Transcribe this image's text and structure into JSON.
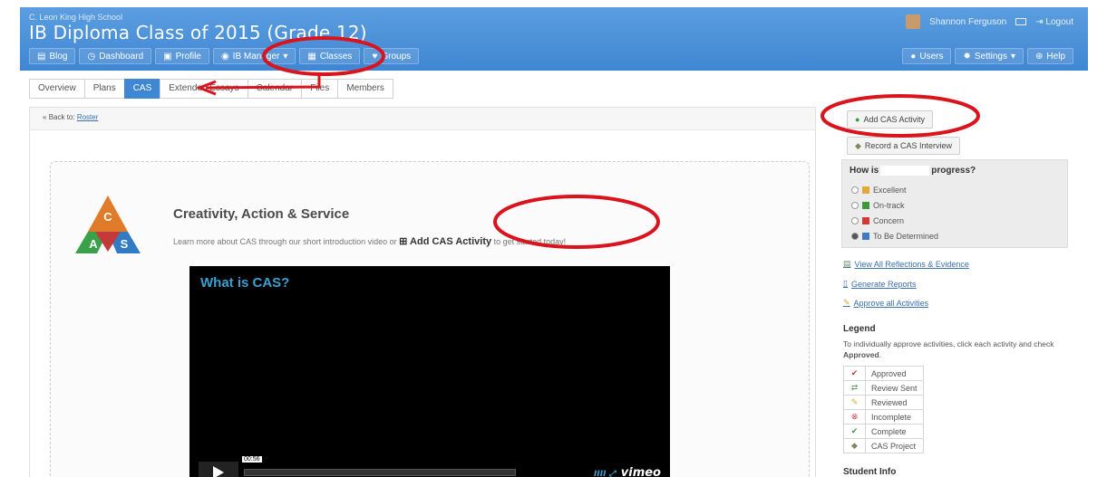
{
  "header": {
    "school": "C. Leon King High School",
    "class_title": "IB Diploma Class of 2015 (Grade 12)",
    "user_name": "Shannon Ferguson",
    "logout": "Logout"
  },
  "nav": {
    "items": [
      {
        "label": "Blog",
        "icon": "blog-icon"
      },
      {
        "label": "Dashboard",
        "icon": "dashboard-icon"
      },
      {
        "label": "Profile",
        "icon": "profile-icon"
      },
      {
        "label": "IB Manager",
        "icon": "globe-icon"
      },
      {
        "label": "Classes",
        "icon": "classes-icon"
      },
      {
        "label": "Groups",
        "icon": "groups-icon"
      }
    ],
    "right": [
      {
        "label": "Users",
        "icon": "user-icon"
      },
      {
        "label": "Settings",
        "icon": "gear-icon"
      },
      {
        "label": "Help",
        "icon": "help-icon"
      }
    ]
  },
  "tabs": [
    "Overview",
    "Plans",
    "CAS",
    "Extended Essays",
    "Calendar",
    "Files",
    "Members"
  ],
  "active_tab": "CAS",
  "breadcrumb": {
    "prefix": "Back to:",
    "link": "Roster"
  },
  "cas": {
    "title": "Creativity, Action & Service",
    "subtitle_pre": "Learn more about CAS through our short introduction video or",
    "subtitle_link": "Add CAS Activity",
    "subtitle_post": "to get started today!",
    "logo_letters": [
      "C",
      "A",
      "S"
    ]
  },
  "video": {
    "title": "What is CAS?",
    "time": "00:56",
    "brand": "vimeo"
  },
  "sidebar": {
    "add_activity": "Add CAS Activity",
    "record_interview": "Record a CAS Interview",
    "progress_title_pre": "How is",
    "progress_title_post": "progress?",
    "progress_options": [
      {
        "label": "Excellent",
        "selected": false,
        "color": "#e0a93a"
      },
      {
        "label": "On-track",
        "selected": false,
        "color": "#3c9a3c"
      },
      {
        "label": "Concern",
        "selected": false,
        "color": "#d33b3b"
      },
      {
        "label": "To Be Determined",
        "selected": true,
        "color": "#3f7bc4"
      }
    ],
    "links": [
      "View All Reflections & Evidence",
      "Generate Reports",
      "Approve all Activities"
    ],
    "legend_title": "Legend",
    "legend_desc_pre": "To individually approve activities, click each activity and check",
    "legend_desc_bold": "Approved",
    "legend": [
      {
        "label": "Approved",
        "icon": "check-icon",
        "color": "#c0392b"
      },
      {
        "label": "Review Sent",
        "icon": "review-sent-icon",
        "color": "#6a9a6a"
      },
      {
        "label": "Reviewed",
        "icon": "pencil-icon",
        "color": "#d9a640"
      },
      {
        "label": "Incomplete",
        "icon": "x-circle-icon",
        "color": "#d33b3b"
      },
      {
        "label": "Complete",
        "icon": "check-circle-icon",
        "color": "#3c9a3c"
      },
      {
        "label": "CAS Project",
        "icon": "project-icon",
        "color": "#7a8a5a"
      }
    ],
    "student_info": "Student Info"
  },
  "colors": {
    "header": "#3f86d3",
    "annotation": "#d9141c"
  }
}
